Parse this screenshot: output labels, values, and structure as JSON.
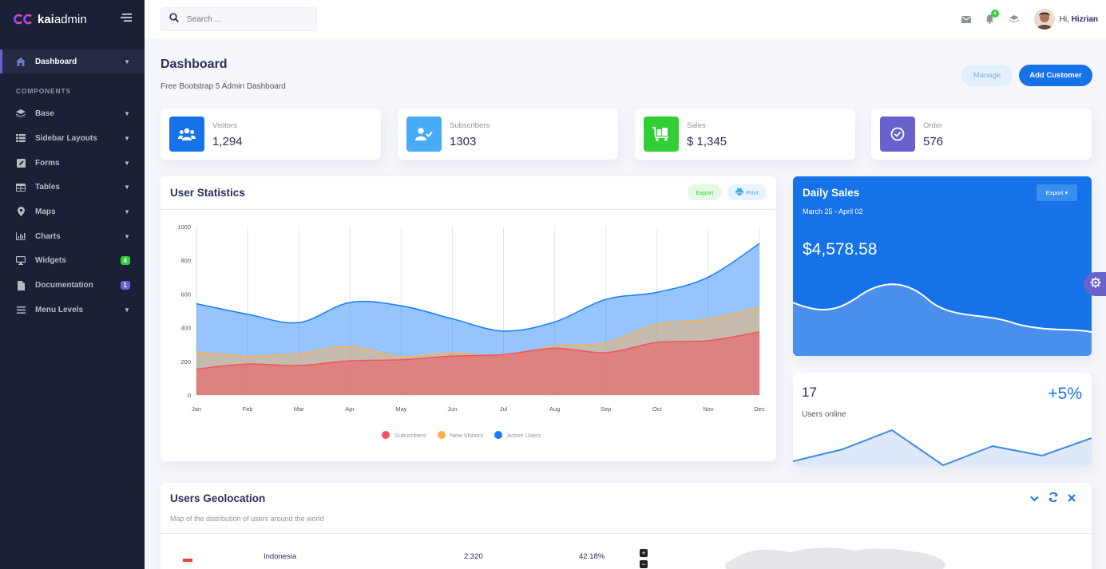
{
  "brand": {
    "kai": "kai",
    "admin": "admin"
  },
  "sidebar": {
    "section_label": "COMPONENTS",
    "active": {
      "label": "Dashboard"
    },
    "items": [
      {
        "label": "Base"
      },
      {
        "label": "Sidebar Layouts"
      },
      {
        "label": "Forms"
      },
      {
        "label": "Tables"
      },
      {
        "label": "Maps"
      },
      {
        "label": "Charts"
      },
      {
        "label": "Widgets",
        "badge": "4"
      },
      {
        "label": "Documentation",
        "badge": "1"
      },
      {
        "label": "Menu Levels"
      }
    ]
  },
  "topbar": {
    "search_placeholder": "Search ...",
    "notification_count": "4",
    "greeting": "Hi,",
    "username": "Hizrian"
  },
  "page": {
    "title": "Dashboard",
    "subtitle": "Free Bootstrap 5 Admin Dashboard",
    "manage_label": "Manage",
    "add_customer_label": "Add Customer"
  },
  "stats": [
    {
      "name": "Visitors",
      "value": "1,294",
      "color": "#1572e8"
    },
    {
      "name": "Subscribers",
      "value": "1303",
      "color": "#48abf7"
    },
    {
      "name": "Sales",
      "value": "$ 1,345",
      "color": "#31ce36"
    },
    {
      "name": "Order",
      "value": "576",
      "color": "#6861ce"
    }
  ],
  "user_stats": {
    "title": "User Statistics",
    "export_label": "Export",
    "print_label": "Print"
  },
  "chart_data": {
    "type": "area",
    "categories": [
      "Jan",
      "Feb",
      "Mar",
      "Apr",
      "May",
      "Jun",
      "Jul",
      "Aug",
      "Sep",
      "Oct",
      "Nov",
      "Dec"
    ],
    "ylim": [
      0,
      1000
    ],
    "yticks": [
      0,
      200,
      400,
      600,
      800,
      1000
    ],
    "grid": true,
    "legend_position": "bottom",
    "series": [
      {
        "name": "Subscribers",
        "color": "#f3545d",
        "values": [
          154,
          184,
          175,
          203,
          210,
          231,
          240,
          278,
          252,
          312,
          323,
          375
        ]
      },
      {
        "name": "New Visitors",
        "color": "#fdaf4b",
        "values": [
          256,
          230,
          245,
          287,
          227,
          250,
          230,
          290,
          310,
          420,
          450,
          520
        ]
      },
      {
        "name": "Active Users",
        "color": "#177dff",
        "values": [
          542,
          480,
          430,
          550,
          530,
          453,
          380,
          434,
          568,
          610,
          700,
          900
        ]
      }
    ]
  },
  "daily_sales": {
    "title": "Daily Sales",
    "range": "March 25 - April 02",
    "amount": "$4,578.58",
    "export_label": "Export"
  },
  "users_online": {
    "count": "17",
    "change": "+5%",
    "label": "Users online"
  },
  "geolocation": {
    "title": "Users Geolocation",
    "subtitle": "Map of the distribution of users around the world",
    "rows": [
      {
        "country": "Indonesia",
        "count": "2.320",
        "percent": "42.18%"
      }
    ]
  }
}
